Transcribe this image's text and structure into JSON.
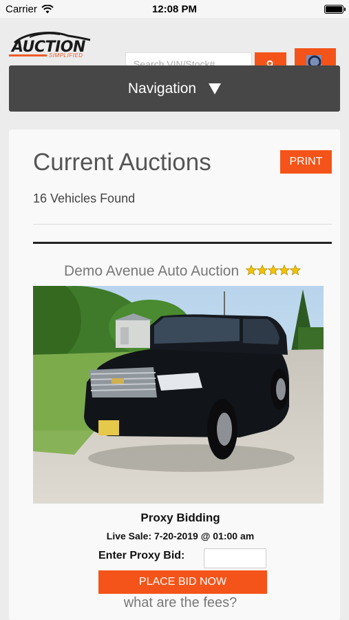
{
  "status_bar": {
    "carrier": "Carrier",
    "time": "12:08 PM"
  },
  "header": {
    "logo_text": "AUCTION",
    "logo_sub": "SIMPLIFIED",
    "search_placeholder": "Search VIN/Stock#"
  },
  "nav": {
    "label": "Navigation"
  },
  "main": {
    "title": "Current Auctions",
    "print_label": "PRINT",
    "vehicle_count": "16 Vehicles Found"
  },
  "listing": {
    "auction_name": "Demo Avenue Auto Auction",
    "rating": 5,
    "bidding_title": "Proxy Bidding",
    "sale_date": "Live Sale: 7-20-2019 @ 01:00 am",
    "bid_label": "Enter Proxy Bid:",
    "place_bid_label": "PLACE BID NOW",
    "fees_link": "what are the fees?"
  },
  "colors": {
    "accent": "#f45419",
    "nav_bg": "#474747",
    "star": "#f2c200"
  }
}
